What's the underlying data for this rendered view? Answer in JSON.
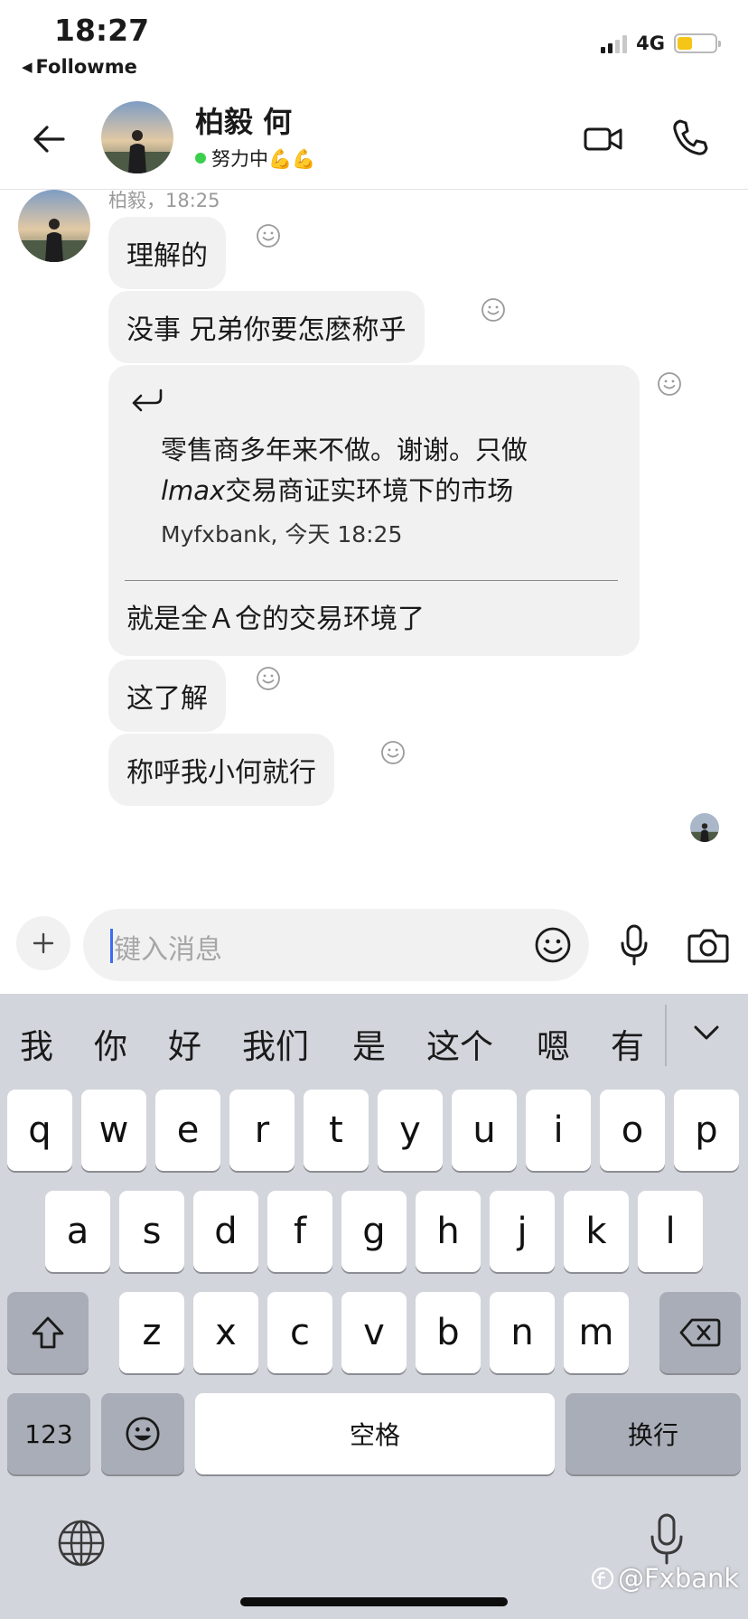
{
  "status_bar": {
    "time": "18:27",
    "back_app": "Followme",
    "network": "4G",
    "battery_level": 0.4,
    "battery_color": "#f5c518"
  },
  "header": {
    "back_icon": "arrow-left-icon",
    "contact_name": "柏毅 何",
    "contact_status": "努力中💪💪",
    "online_color": "#3ccf4e",
    "video_icon": "video-camera-icon",
    "call_icon": "phone-icon"
  },
  "messages": {
    "sender_meta": "柏毅，18:25",
    "items": [
      {
        "text": "理解的"
      },
      {
        "text": "没事 兄弟你要怎麽称乎"
      },
      {
        "text": "这了解"
      },
      {
        "text": "称呼我小何就行"
      }
    ],
    "quote": {
      "line1": "零售商多年来不做。谢谢。只做",
      "line2_italic": "lmax",
      "line2_rest": "交易商证实环境下的市场",
      "source": "Myfxbank, 今天 18:25",
      "reply": "就是全Ａ仓的交易环境了"
    }
  },
  "composer": {
    "placeholder": "键入消息",
    "plus_icon": "plus-icon",
    "emoji_icon": "smiley-icon",
    "mic_icon": "microphone-icon",
    "camera_icon": "camera-icon"
  },
  "keyboard": {
    "candidates": [
      "我",
      "你",
      "好",
      "我们",
      "是",
      "这个",
      "嗯",
      "有"
    ],
    "row1": [
      "q",
      "w",
      "e",
      "r",
      "t",
      "y",
      "u",
      "i",
      "o",
      "p"
    ],
    "row2": [
      "a",
      "s",
      "d",
      "f",
      "g",
      "h",
      "j",
      "k",
      "l"
    ],
    "row3": [
      "z",
      "x",
      "c",
      "v",
      "b",
      "n",
      "m"
    ],
    "numbers_label": "123",
    "space_label": "空格",
    "return_label": "换行",
    "watermark": "@Fxbank"
  }
}
